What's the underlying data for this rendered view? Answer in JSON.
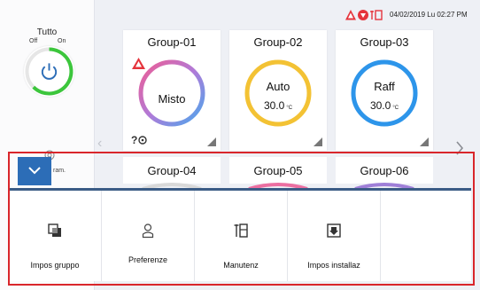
{
  "status": {
    "datetime": "04/02/2019 Lu 02:27 PM",
    "icons": [
      "alert-triangle-icon",
      "shield-icon",
      "maintenance-icon"
    ]
  },
  "master": {
    "label": "Tutto",
    "off_label": "Off",
    "on_label": "On",
    "state": "on"
  },
  "groups": [
    {
      "name": "Group-01",
      "mode": "Misto",
      "temp": "",
      "unit": "",
      "ring": "gradient",
      "alert": true
    },
    {
      "name": "Group-02",
      "mode": "Auto",
      "temp": "30.0",
      "unit": "°C",
      "ring": "#f3c234",
      "alert": false
    },
    {
      "name": "Group-03",
      "mode": "Raff",
      "temp": "30.0",
      "unit": "°C",
      "ring": "#2d95ea",
      "alert": false
    },
    {
      "name": "Group-04"
    },
    {
      "name": "Group-05"
    },
    {
      "name": "Group-06"
    }
  ],
  "side_fragment": "ram.",
  "panel": [
    {
      "label": "Impos gruppo",
      "icon": "group-settings-icon"
    },
    {
      "label": "Preferenze",
      "icon": "user-icon"
    },
    {
      "label": "Manutenz",
      "icon": "maintenance-icon"
    },
    {
      "label": "Impos installaz",
      "icon": "install-settings-icon"
    }
  ],
  "colors": {
    "accent": "#2c6db7",
    "power_on": "#3cc63c",
    "alert": "#e5343c",
    "highlight_frame": "#d9262b"
  }
}
